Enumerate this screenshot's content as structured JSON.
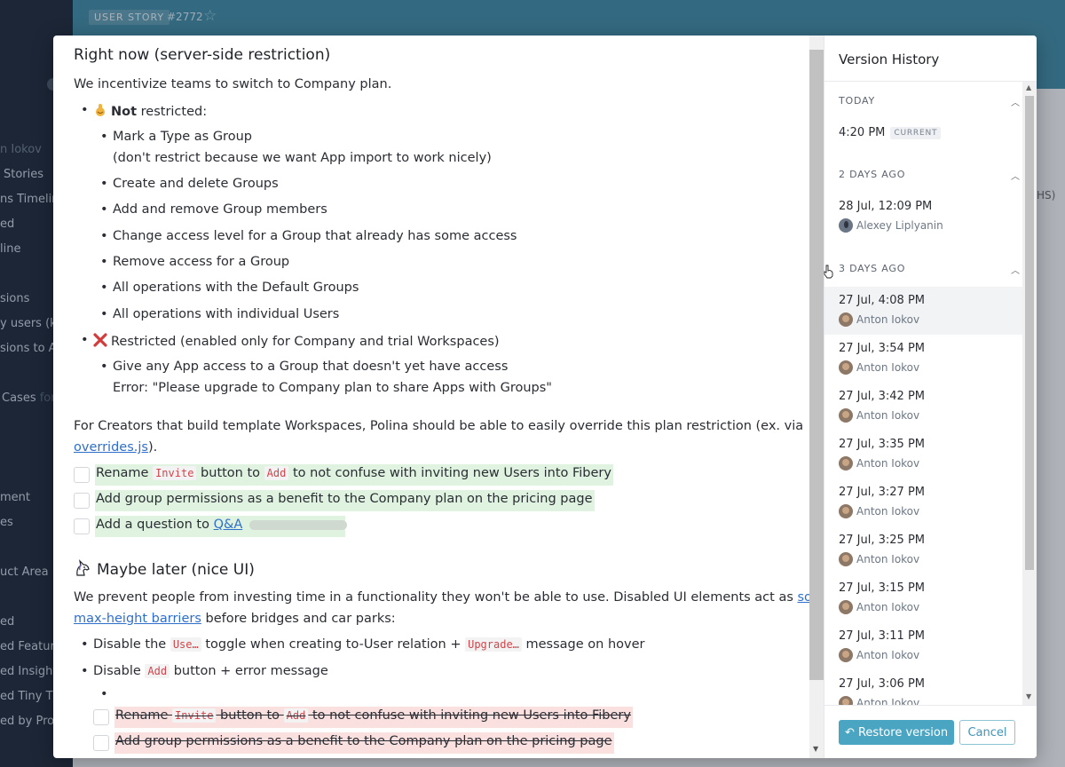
{
  "background": {
    "header": {
      "type_badge": "USER STORY",
      "entity_id": "#2772"
    },
    "sidebar": {
      "items": [
        {
          "label": "n Iokov",
          "muted": true
        },
        {
          "label": "Stories"
        },
        {
          "label": "ns Timeline"
        },
        {
          "label": "ed"
        },
        {
          "label": "line"
        },
        {
          "label": "sions"
        },
        {
          "label": "y users (kin"
        },
        {
          "label": "sions to Ap"
        },
        {
          "label": "Cases",
          "suffix": "for"
        },
        {
          "label": "ment"
        },
        {
          "label": "es"
        },
        {
          "label": "uct Area"
        },
        {
          "label": "ed"
        },
        {
          "label": "ed Features"
        },
        {
          "label": "ed Insights"
        },
        {
          "label": "ed Tiny Thi"
        },
        {
          "label": "ed by Prod"
        }
      ]
    },
    "right_fragment": "HS)"
  },
  "document": {
    "section1_title": "Right now (server-side restriction)",
    "intro": "We incentivize teams to switch to Company plan.",
    "not_restricted": {
      "bold": "Not",
      "rest": " restricted:"
    },
    "not_restricted_items": [
      {
        "text": "Mark a Type as Group",
        "sub": "(don't restrict because we want App import to work nicely)"
      },
      {
        "text": "Create and delete Groups"
      },
      {
        "text": "Add and remove Group members"
      },
      {
        "text": "Change access level for a Group that already has some access"
      },
      {
        "text": "Remove access for a Group"
      },
      {
        "text": "All operations with the Default Groups"
      },
      {
        "text": "All operations with individual Users"
      }
    ],
    "restricted": "Restricted (enabled only for Company and trial Workspaces)",
    "restricted_items": [
      {
        "text": "Give any App access to a Group that doesn't yet have access",
        "sub": "Error: \"Please upgrade to Company plan to share Apps with Groups\""
      }
    ],
    "creators_text": "For Creators that build template Workspaces, Polina should be able to easily override this plan restriction (ex. via",
    "creators_link": "overrides.js",
    "creators_end": ").",
    "todos": {
      "t1": {
        "a": "Rename ",
        "code1": "Invite",
        "b": " button to ",
        "code2": "Add",
        "c": " to not confuse with inviting new Users into Fibery"
      },
      "t2": "Add group permissions as a benefit to the Company plan on the pricing page",
      "t3": {
        "a": "Add a question to ",
        "link": "Q&A"
      }
    },
    "section2_title": "Maybe later (nice UI)",
    "later_text_a": "We prevent people from investing time in a functionality they won't be able to use. Disabled UI elements act as",
    "later_link_a": "soft",
    "later_link_b": "max-height barriers",
    "later_text_b": " before bridges and car parks:",
    "later_items": {
      "i1": {
        "a": "Disable the ",
        "code1": "Use…",
        "b": " toggle when creating to-User relation + ",
        "code2": "Upgrade…",
        "c": " message on hover"
      },
      "i2": {
        "a": "Disable ",
        "code1": "Add",
        "b": " button + error message"
      }
    },
    "struck": {
      "s1": {
        "a": "Rename ",
        "code1": "Invite",
        "b": " button to ",
        "code2": "Add",
        "c": " to not confuse with inviting new Users into Fibery"
      },
      "s2": "Add group permissions as a benefit to the Company plan on the pricing page"
    }
  },
  "version_history": {
    "title": "Version History",
    "groups": [
      {
        "label": "TODAY",
        "entries": [
          {
            "time": "4:20 PM",
            "badge": "CURRENT"
          }
        ]
      },
      {
        "label": "2 DAYS AGO",
        "entries": [
          {
            "time": "28 Jul, 12:09 PM",
            "author": "Alexey Liplyanin"
          }
        ]
      },
      {
        "label": "3 DAYS AGO",
        "entries": [
          {
            "time": "27 Jul, 4:08 PM",
            "author": "Anton Iokov"
          },
          {
            "time": "27 Jul, 3:54 PM",
            "author": "Anton Iokov"
          },
          {
            "time": "27 Jul, 3:42 PM",
            "author": "Anton Iokov"
          },
          {
            "time": "27 Jul, 3:35 PM",
            "author": "Anton Iokov"
          },
          {
            "time": "27 Jul, 3:27 PM",
            "author": "Anton Iokov"
          },
          {
            "time": "27 Jul, 3:25 PM",
            "author": "Anton Iokov"
          },
          {
            "time": "27 Jul, 3:15 PM",
            "author": "Anton Iokov"
          },
          {
            "time": "27 Jul, 3:11 PM",
            "author": "Anton Iokov"
          },
          {
            "time": "27 Jul, 3:06 PM",
            "author": "Anton Iokov"
          }
        ]
      }
    ],
    "restore_label": "Restore version",
    "cancel_label": "Cancel"
  },
  "colors": {
    "accent": "#4aa5c2",
    "link": "#2f6fcc",
    "added_highlight": "#dff3e0",
    "removed_highlight": "#fbe0e0"
  }
}
